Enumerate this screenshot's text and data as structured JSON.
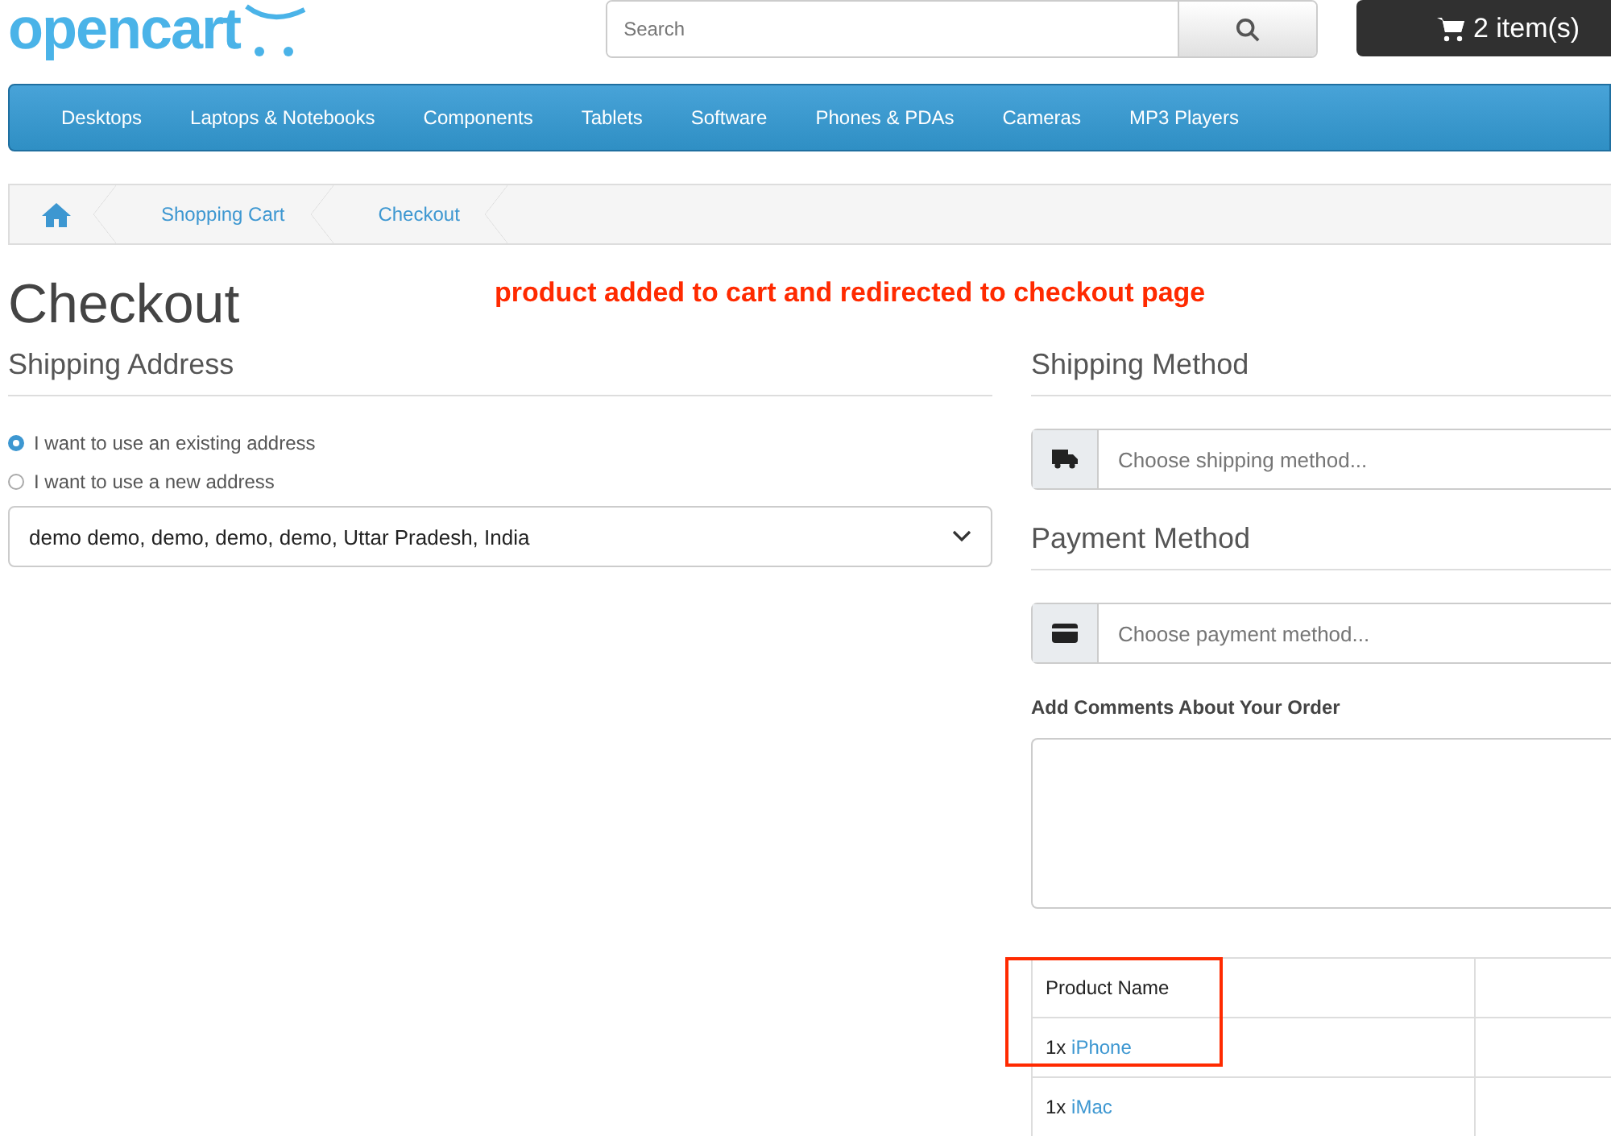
{
  "header": {
    "logo": "opencart",
    "search": {
      "placeholder": "Search"
    },
    "cart": "2 item(s)"
  },
  "menu": [
    {
      "label": "Desktops"
    },
    {
      "label": "Laptops & Notebooks"
    },
    {
      "label": "Components"
    },
    {
      "label": "Tablets"
    },
    {
      "label": "Software"
    },
    {
      "label": "Phones & PDAs"
    },
    {
      "label": "Cameras"
    },
    {
      "label": "MP3 Players"
    }
  ],
  "breadcrumb": [
    "Shopping Cart",
    "Checkout"
  ],
  "title": "Checkout",
  "annotation": "product added to cart and redirected to checkout page",
  "shipping_address": {
    "heading": "Shipping Address",
    "options": [
      {
        "label": "I want to use an existing address",
        "selected": true
      },
      {
        "label": "I want to use a new address",
        "selected": false
      }
    ],
    "address": "demo demo, demo, demo, demo, Uttar Pradesh, India"
  },
  "shipping_method": {
    "heading": "Shipping Method",
    "placeholder": "Choose shipping method..."
  },
  "payment_method": {
    "heading": "Payment Method",
    "placeholder": "Choose payment method..."
  },
  "comments": {
    "label": "Add Comments About Your Order"
  },
  "table": {
    "columns": [
      "Product Name"
    ],
    "rows": [
      {
        "qty": "1x",
        "product": "iPhone",
        "highlighted": true
      },
      {
        "qty": "1x",
        "product": "iMac",
        "highlighted": false
      }
    ]
  }
}
